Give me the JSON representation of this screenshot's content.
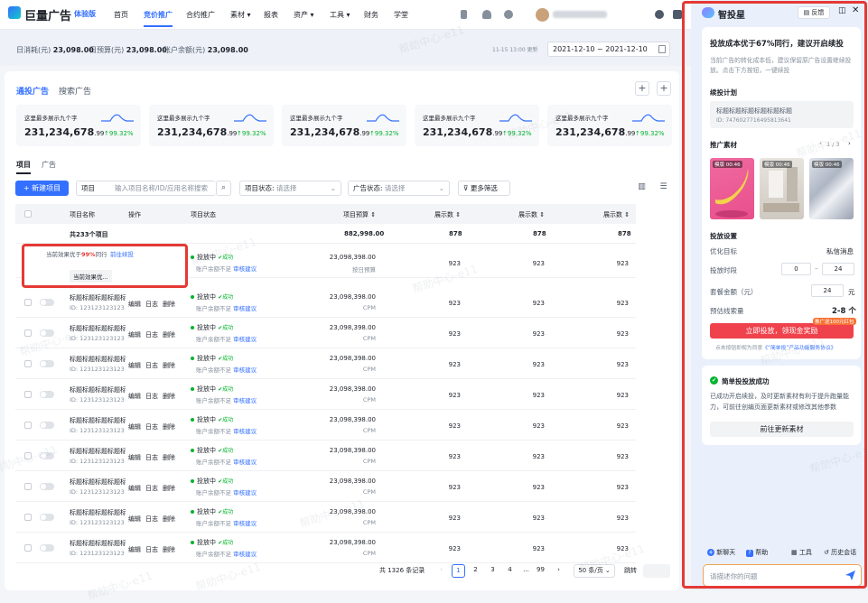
{
  "app": {
    "brand": "巨量广告",
    "edition": "体验版"
  },
  "nav": {
    "items": [
      "首页",
      "竞价推广",
      "合约推广",
      "素材 ▾",
      "报表",
      "资产 ▾",
      "工具 ▾",
      "财务",
      "学堂"
    ],
    "active": 1
  },
  "stats": {
    "today_spend_label": "日消耗(元)",
    "today_spend": "23,098.00",
    "today_budget_label": "日预算(元)",
    "today_budget": "23,098.00",
    "balance_label": "账户余额(元)",
    "balance": "23,098.00",
    "update_time": "11-15 13:00 更新",
    "date_range": "2021-12-10 ~ 2021-12-10"
  },
  "main_tabs": [
    "通投广告",
    "搜索广告"
  ],
  "metric_cards": [
    {
      "title": "这里最多展示九个字",
      "value": "231,234,678",
      "decimal": ".99",
      "change": "↑99.32%"
    },
    {
      "title": "这里最多展示九个字",
      "value": "231,234,678",
      "decimal": ".99",
      "change": "↑99.32%"
    },
    {
      "title": "这里最多展示九个字",
      "value": "231,234,678",
      "decimal": ".99",
      "change": "↑99.32%"
    },
    {
      "title": "这里最多展示九个字",
      "value": "231,234,678",
      "decimal": ".99",
      "change": "↑99.32%"
    },
    {
      "title": "这里最多展示九个字",
      "value": "231,234,678",
      "decimal": ".99",
      "change": "↑99.32%"
    }
  ],
  "sub_tabs": [
    "项目",
    "广告"
  ],
  "toolbar": {
    "new_project": "+ 新建项目",
    "scope_label": "项目",
    "search_placeholder": "输入项目名称/ID/应用名称搜索",
    "status_label": "项目状态:",
    "status_value": "请选择",
    "ad_status_label": "广告状态:",
    "ad_status_value": "请选择",
    "more_filters": "更多筛选"
  },
  "table": {
    "headers": [
      "项目名称",
      "操作",
      "项目状态",
      "项目预算 ⇕",
      "展示数 ⇕",
      "展示数 ⇕",
      "展示数 ⇕"
    ],
    "total": {
      "label": "共233个项目",
      "budget": "882,998.00",
      "c1": "878",
      "c2": "878",
      "c3": "878"
    },
    "op_labels": [
      "编辑",
      "日志",
      "删除"
    ],
    "status": {
      "running": "投放中",
      "ok": "✔成功",
      "note": "账户余额不足",
      "link": "审核建议"
    },
    "rows": [
      {
        "name": "标题标题标题标题标题",
        "id": "ID: 123123123123",
        "budget": "23,098,398.00",
        "budget_sub": "按日预算",
        "c1": "923",
        "c2": "923",
        "c3": "923"
      },
      {
        "name": "标题标题标题标题标题",
        "id": "ID: 123123123123",
        "budget": "23,098,398.00",
        "budget_sub": "CPM",
        "c1": "923",
        "c2": "923",
        "c3": "923"
      },
      {
        "name": "标题标题标题标题标题",
        "id": "ID: 123123123123",
        "budget": "23,098,398.00",
        "budget_sub": "CPM",
        "c1": "923",
        "c2": "923",
        "c3": "923"
      },
      {
        "name": "标题标题标题标题标题",
        "id": "ID: 123123123123",
        "budget": "23,098,398.00",
        "budget_sub": "CPM",
        "c1": "923",
        "c2": "923",
        "c3": "923"
      },
      {
        "name": "标题标题标题标题标题",
        "id": "ID: 123123123123",
        "budget": "23,098,398.00",
        "budget_sub": "CPM",
        "c1": "923",
        "c2": "923",
        "c3": "923"
      },
      {
        "name": "标题标题标题标题标题",
        "id": "ID: 123123123123",
        "budget": "23,098,398.00",
        "budget_sub": "CPM",
        "c1": "923",
        "c2": "923",
        "c3": "923"
      },
      {
        "name": "标题标题标题标题标题",
        "id": "ID: 123123123123",
        "budget": "23,098,398.00",
        "budget_sub": "CPM",
        "c1": "923",
        "c2": "923",
        "c3": "923"
      },
      {
        "name": "标题标题标题标题标题",
        "id": "ID: 123123123123",
        "budget": "23,098,398.00",
        "budget_sub": "CPM",
        "c1": "923",
        "c2": "923",
        "c3": "923"
      },
      {
        "name": "标题标题标题标题标题",
        "id": "ID: 123123123123",
        "budget": "23,098,398.00",
        "budget_sub": "CPM",
        "c1": "923",
        "c2": "923",
        "c3": "923"
      },
      {
        "name": "标题标题标题标题标题",
        "id": "ID: 123123123123",
        "budget": "23,098,398.00",
        "budget_sub": "CPM",
        "c1": "923",
        "c2": "923",
        "c3": "923"
      }
    ]
  },
  "popover": {
    "text_pre": "当前效果优于",
    "text_pct": "99%",
    "text_post": "同行",
    "link": "前往续投",
    "button": "当前效果优..."
  },
  "pagination": {
    "total": "共 1326 条记录",
    "pages": [
      "1",
      "2",
      "3",
      "4",
      "...",
      "99"
    ],
    "active": "1",
    "page_size": "50 条/页 ⌄",
    "jump": "跳转"
  },
  "panel": {
    "title": "智投星",
    "feedback": "反馈",
    "headline": "投放成本优于67%同行，建议开启续投",
    "desc": "当前广告的转化成本低，建议保留原广告设置继续投放。点击下方按钮，一键续投",
    "plan_label": "续投计划",
    "plan_name": "标题标题标题标题标题标题",
    "plan_id": "ID: 7476027716495813641",
    "materials_label": "推广素材",
    "materials_page": "1 / 3",
    "material_tags": [
      [
        "模版",
        "00:46"
      ],
      [
        "模版",
        "00:46"
      ],
      [
        "模版",
        "00:46"
      ]
    ],
    "settings_label": "投放设置",
    "goal_label": "优化目标",
    "goal_value": "私信消息",
    "time_label": "投放时段",
    "time_from": "0",
    "time_to": "24",
    "budget_label": "套餐金额（元）",
    "budget_value": "24",
    "budget_unit": "元",
    "estimate_label": "预估线索量",
    "estimate_value": "2-8 个",
    "promo_tag": "推广送100元红包",
    "cta": "立即投放，领现金奖励",
    "agreement_pre": "点击按钮即视为同意",
    "agreement_link": "《“简单投”产品功能服务协议》",
    "success_title": "简单投投放成功",
    "success_desc": "已成功开启续投，及时更新素材有利于提升跑量能力，可前往创编页面更新素材或修改其他参数",
    "update_btn": "前往更新素材",
    "bottom": {
      "new_chat": "新聊天",
      "help": "帮助",
      "tools": "工具",
      "history": "历史会话"
    },
    "input_placeholder": "请描述你的问题"
  },
  "watermark": "帮助中心-e11",
  "colors": {
    "primary": "#3370ff",
    "success": "#00b42a",
    "danger": "#f0424c",
    "highlight": "#e53935"
  }
}
